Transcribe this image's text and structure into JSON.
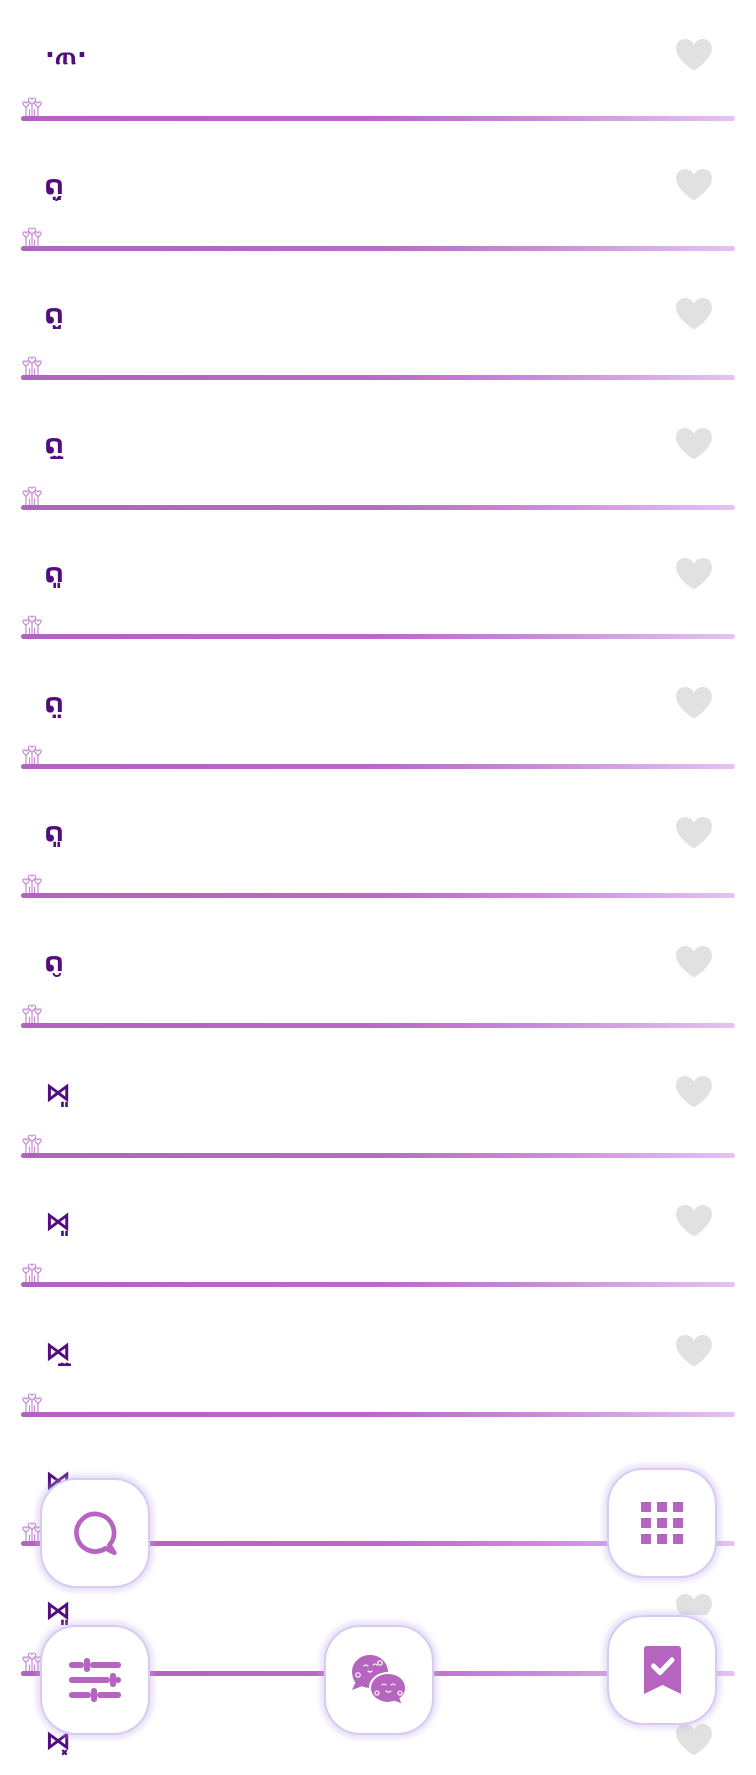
{
  "rows": [
    {
      "face": "·ጠ·",
      "liked": false
    },
    {
      "face": "ດ̤̗",
      "liked": false
    },
    {
      "face": "ດ̤̮",
      "liked": false
    },
    {
      "face": "ດ̤̲",
      "liked": false
    },
    {
      "face": "ດ͈",
      "liked": false
    },
    {
      "face": "ດ̤̤",
      "liked": false
    },
    {
      "face": "ດ͈",
      "liked": false
    },
    {
      "face": "ດ̮",
      "liked": false
    },
    {
      "face": "⋈͈",
      "liked": false
    },
    {
      "face": "⋈͈",
      "liked": false
    },
    {
      "face": "⋈̤̲",
      "liked": false
    },
    {
      "face": "⋈"
    },
    {
      "face": "⋈͈",
      "liked": false
    },
    {
      "face": "⋈͓",
      "liked": false
    }
  ]
}
